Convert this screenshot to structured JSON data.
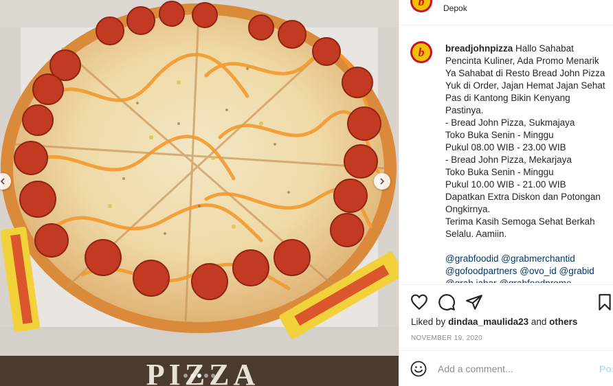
{
  "post": {
    "location": "Depok",
    "username": "breadjohnpizza",
    "caption_lines": [
      "Hallo Sahabat",
      "Pencinta Kuliner, Ada Promo Menarik",
      "Ya Sahabat di Resto Bread John Pizza",
      "Yuk di Order, Jajan Hemat Jajan Sehat",
      "Pas di Kantong Bikin Kenyang",
      "Pastinya.",
      "- Bread John Pizza, Sukmajaya",
      "Toko Buka Senin - Minggu",
      "Pukul 08.00 WIB - 23.00 WIB",
      "- Bread John Pizza, Mekarjaya",
      "Toko Buka Senin - Minggu",
      "Pukul 10.00 WIB - 21.00 WIB",
      "Dapatkan Extra Diskon dan Potongan",
      "Ongkirnya.",
      "Terima Kasih Semoga Sehat Berkah",
      "Selalu. Aamiin."
    ],
    "tag_lines": [
      "@grabfoodid @grabmerchantid",
      "@gofoodpartners @ovo_id @grabid",
      "@grab.jabar @grabfoodpromo"
    ],
    "likes_prefix": "Liked by",
    "liked_by_user": "dindaa_maulida23",
    "likes_and": "and",
    "likes_others": "others",
    "date": "NOVEMBER 19, 2020",
    "comment_placeholder": "Add a comment...",
    "post_button": "Post"
  },
  "photo": {
    "box_print": "PIZZA",
    "carousel_count": 5,
    "active_index": 2
  },
  "icons": {
    "like": "heart-icon",
    "comment": "comment-icon",
    "share": "paper-plane-icon",
    "save": "bookmark-icon",
    "emoji": "smiley-icon",
    "prev": "chevron-left-icon",
    "next": "chevron-right-icon"
  },
  "colors": {
    "brand_red": "#c8102e",
    "brand_yellow": "#f2c200",
    "link": "#00376b",
    "post_button": "#b2dffc"
  }
}
